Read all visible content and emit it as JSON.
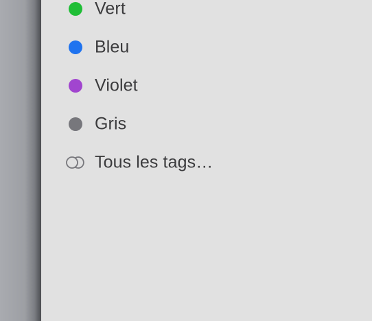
{
  "sidebar": {
    "tags": [
      {
        "label": "Vert",
        "color": "#1fbe36",
        "icon": "green-tag-dot"
      },
      {
        "label": "Bleu",
        "color": "#1f73ef",
        "icon": "blue-tag-dot"
      },
      {
        "label": "Violet",
        "color": "#a145cf",
        "icon": "purple-tag-dot"
      },
      {
        "label": "Gris",
        "color": "#77777c",
        "icon": "gray-tag-dot"
      }
    ],
    "all_tags": {
      "label": "Tous les tags…",
      "icon": "all-tags-icon"
    }
  }
}
